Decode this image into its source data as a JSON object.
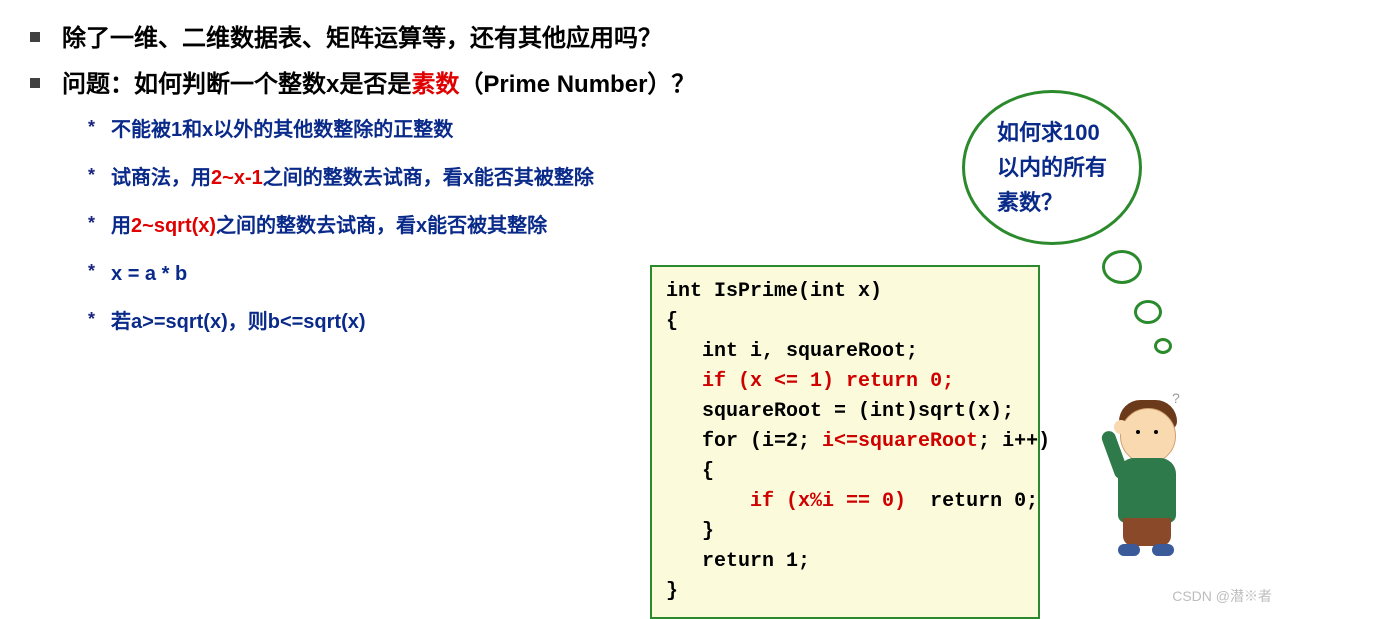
{
  "main_bullets": [
    {
      "text_full": "除了一维、二维数据表、矩阵运算等，还有其他应用吗？"
    },
    {
      "prefix": "问题：如何判断一个整数x是否是",
      "highlight": "素数",
      "suffix": "（Prime Number）？"
    }
  ],
  "sub_bullets": [
    {
      "plain": "不能被1和x以外的其他数整除的正整数"
    },
    {
      "p1": "试商法，用",
      "r": "2~x-1",
      "p2": "之间的整数去试商，看x能否其被整除"
    },
    {
      "p1": "用",
      "r": "2~sqrt(x)",
      "p2": "之间的整数去试商，看x能否被其整除"
    },
    {
      "plain": "x = a * b"
    },
    {
      "plain": "若a>=sqrt(x)，则b<=sqrt(x)"
    }
  ],
  "code": {
    "l1": "int IsPrime(int x)",
    "l2": "{",
    "l3": "   int i, squareRoot;",
    "l4a": "   if",
    "l4b": " (x <= 1) ",
    "l4c": "return",
    "l4d": " 0;",
    "l5": "   squareRoot = (int)sqrt(x);",
    "l6a": "   for",
    "l6b": " (i=2; ",
    "l6c": "i<=squareRoot",
    "l6d": "; i++)",
    "l7": "   {",
    "l8a": "       if",
    "l8b": " (x%i == 0)  ",
    "l8c": "return",
    "l8d": " 0;",
    "l9": "   }",
    "l10a": "   return",
    "l10b": " 1;",
    "l11": "}"
  },
  "bubble": {
    "line1": "如何求100",
    "line2": "以内的所有",
    "line3": "素数？"
  },
  "watermark": "CSDN @潜※者"
}
